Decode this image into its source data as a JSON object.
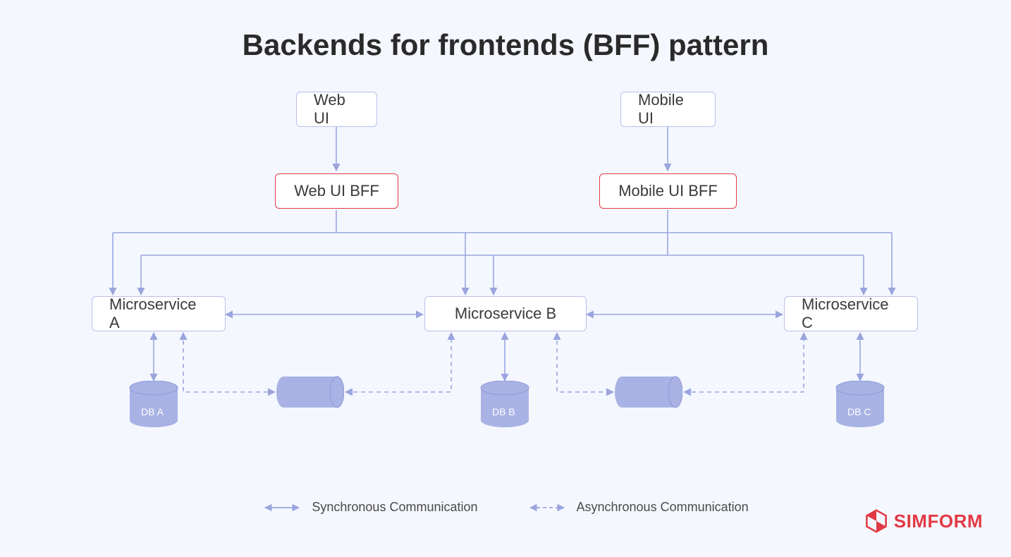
{
  "title": "Backends for frontends (BFF) pattern",
  "nodes": {
    "web_ui": "Web UI",
    "mobile_ui": "Mobile UI",
    "web_bff": "Web UI BFF",
    "mobile_bff": "Mobile UI BFF",
    "ms_a": "Microservice A",
    "ms_b": "Microservice B",
    "ms_c": "Microservice C",
    "db_a": "DB A",
    "db_b": "DB B",
    "db_c": "DB C"
  },
  "legend": {
    "sync": "Synchronous Communication",
    "async": "Asynchronous Communication"
  },
  "brand": "SIMFORM",
  "colors": {
    "line": "#9aa5dd",
    "fill": "#a8b2e4",
    "red": "#e13a45",
    "bg": "#f5f7ff"
  }
}
